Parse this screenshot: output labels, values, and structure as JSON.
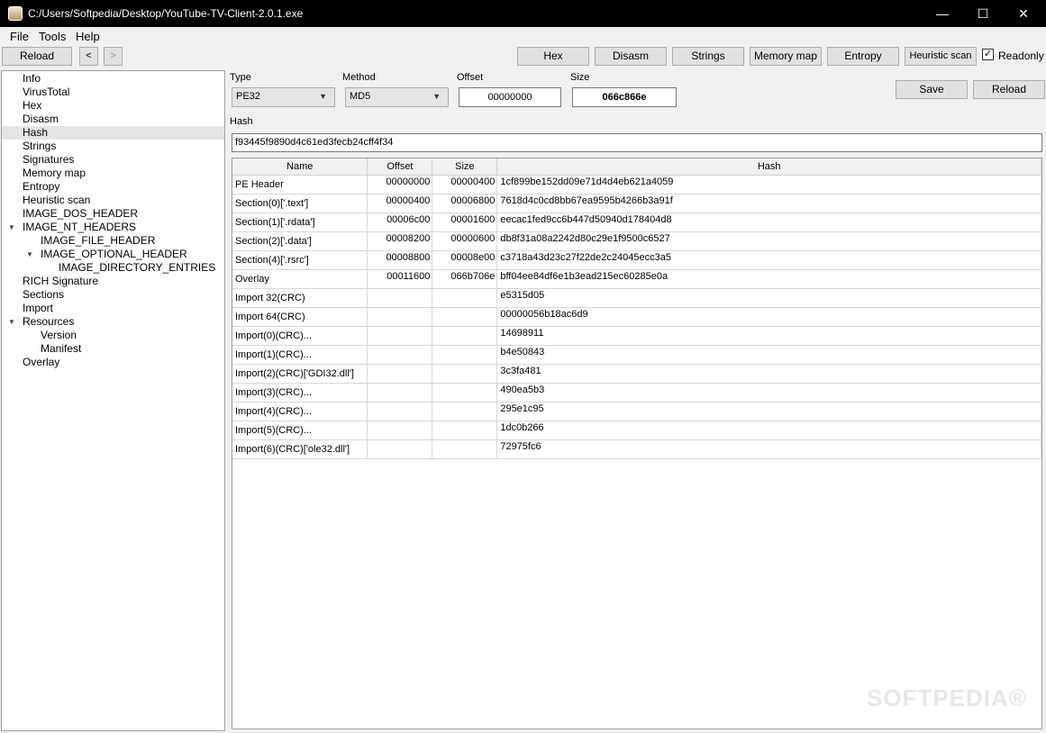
{
  "window": {
    "title": "C:/Users/Softpedia/Desktop/YouTube-TV-Client-2.0.1.exe",
    "minimize": "—",
    "maximize": "☐",
    "close": "✕"
  },
  "menu": [
    "File",
    "Tools",
    "Help"
  ],
  "toolbar": {
    "reload": "Reload",
    "back": "<",
    "forward": ">",
    "tabs": [
      "Hex",
      "Disasm",
      "Strings",
      "Memory map",
      "Entropy",
      "Heuristic scan"
    ],
    "readonly_label": "Readonly",
    "readonly_checked": true
  },
  "tree": [
    {
      "label": "Info",
      "level": 0
    },
    {
      "label": "VirusTotal",
      "level": 0
    },
    {
      "label": "Hex",
      "level": 0
    },
    {
      "label": "Disasm",
      "level": 0
    },
    {
      "label": "Hash",
      "level": 0,
      "selected": true
    },
    {
      "label": "Strings",
      "level": 0
    },
    {
      "label": "Signatures",
      "level": 0
    },
    {
      "label": "Memory map",
      "level": 0
    },
    {
      "label": "Entropy",
      "level": 0
    },
    {
      "label": "Heuristic scan",
      "level": 0
    },
    {
      "label": "IMAGE_DOS_HEADER",
      "level": 0
    },
    {
      "label": "IMAGE_NT_HEADERS",
      "level": 0,
      "expanded": true
    },
    {
      "label": "IMAGE_FILE_HEADER",
      "level": 1
    },
    {
      "label": "IMAGE_OPTIONAL_HEADER",
      "level": 1,
      "expanded": true
    },
    {
      "label": "IMAGE_DIRECTORY_ENTRIES",
      "level": 2
    },
    {
      "label": "RICH Signature",
      "level": 0
    },
    {
      "label": "Sections",
      "level": 0
    },
    {
      "label": "Import",
      "level": 0
    },
    {
      "label": "Resources",
      "level": 0,
      "expanded": true
    },
    {
      "label": "Version",
      "level": 1
    },
    {
      "label": "Manifest",
      "level": 1
    },
    {
      "label": "Overlay",
      "level": 0
    }
  ],
  "params": {
    "type_label": "Type",
    "type_value": "PE32",
    "method_label": "Method",
    "method_value": "MD5",
    "offset_label": "Offset",
    "offset_value": "00000000",
    "size_label": "Size",
    "size_value": "066c866e",
    "save": "Save",
    "reload": "Reload",
    "hash_label": "Hash",
    "hash_value": "f93445f9890d4c61ed3fecb24cff4f34"
  },
  "table": {
    "columns": [
      "Name",
      "Offset",
      "Size",
      "Hash"
    ],
    "rows": [
      [
        "PE Header",
        "00000000",
        "00000400",
        "1cf899be152dd09e71d4d4eb621a4059"
      ],
      [
        "Section(0)['.text']",
        "00000400",
        "00006800",
        "7618d4c0cd8bb67ea9595b4266b3a91f"
      ],
      [
        "Section(1)['.rdata']",
        "00006c00",
        "00001600",
        "eecac1fed9cc6b447d50940d178404d8"
      ],
      [
        "Section(2)['.data']",
        "00008200",
        "00000600",
        "db8f31a08a2242d80c29e1f9500c6527"
      ],
      [
        "Section(4)['.rsrc']",
        "00008800",
        "00008e00",
        "c3718a43d23c27f22de2c24045ecc3a5"
      ],
      [
        "Overlay",
        "00011600",
        "066b706e",
        "bff04ee84df6e1b3ead215ec60285e0a"
      ],
      [
        "Import 32(CRC)",
        "",
        "",
        "e5315d05"
      ],
      [
        "Import 64(CRC)",
        "",
        "",
        "00000056b18ac6d9"
      ],
      [
        "Import(0)(CRC)...",
        "",
        "",
        "14698911"
      ],
      [
        "Import(1)(CRC)...",
        "",
        "",
        "b4e50843"
      ],
      [
        "Import(2)(CRC)['GDI32.dll']",
        "",
        "",
        "3c3fa481"
      ],
      [
        "Import(3)(CRC)...",
        "",
        "",
        "490ea5b3"
      ],
      [
        "Import(4)(CRC)...",
        "",
        "",
        "295e1c95"
      ],
      [
        "Import(5)(CRC)...",
        "",
        "",
        "1dc0b266"
      ],
      [
        "Import(6)(CRC)['ole32.dll']",
        "",
        "",
        "72975fc6"
      ]
    ]
  },
  "watermark": "SOFTPEDIA®"
}
